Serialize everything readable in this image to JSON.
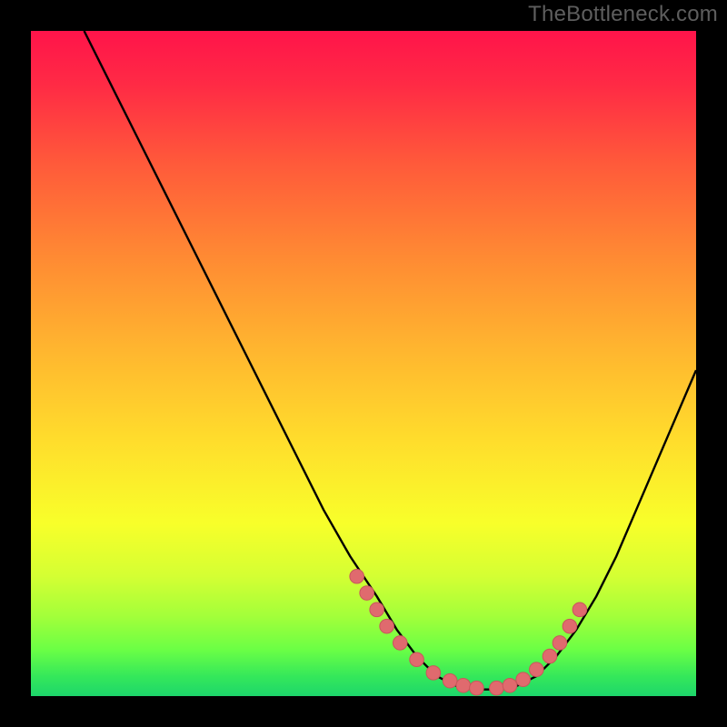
{
  "watermark": "TheBottleneck.com",
  "colors": {
    "background": "#000000",
    "gradient_top": "#ff144a",
    "gradient_bottom": "#1dd66b",
    "curve": "#000000",
    "marker_fill": "#e06a6e",
    "marker_stroke": "#c9575b"
  },
  "chart_data": {
    "type": "line",
    "title": "",
    "xlabel": "",
    "ylabel": "",
    "xlim": [
      0,
      100
    ],
    "ylim": [
      0,
      100
    ],
    "grid": false,
    "legend": false,
    "series": [
      {
        "name": "bottleneck-curve",
        "x": [
          8,
          12,
          16,
          20,
          24,
          28,
          32,
          36,
          40,
          44,
          48,
          52,
          55,
          58,
          61,
          64,
          67,
          70,
          73,
          76,
          79,
          82,
          85,
          88,
          91,
          94,
          97,
          100
        ],
        "y": [
          100,
          92,
          84,
          76,
          68,
          60,
          52,
          44,
          36,
          28,
          21,
          15,
          10,
          6,
          3,
          1.5,
          1,
          1,
          1.5,
          3,
          6,
          10,
          15,
          21,
          28,
          35,
          42,
          49
        ]
      }
    ],
    "markers": {
      "name": "highlight-points",
      "x": [
        49,
        50.5,
        52,
        53.5,
        55.5,
        58,
        60.5,
        63,
        65,
        67,
        70,
        72,
        74,
        76,
        78,
        79.5,
        81,
        82.5
      ],
      "y": [
        18,
        15.5,
        13,
        10.5,
        8,
        5.5,
        3.5,
        2.3,
        1.6,
        1.2,
        1.2,
        1.6,
        2.5,
        4,
        6,
        8,
        10.5,
        13
      ]
    }
  }
}
